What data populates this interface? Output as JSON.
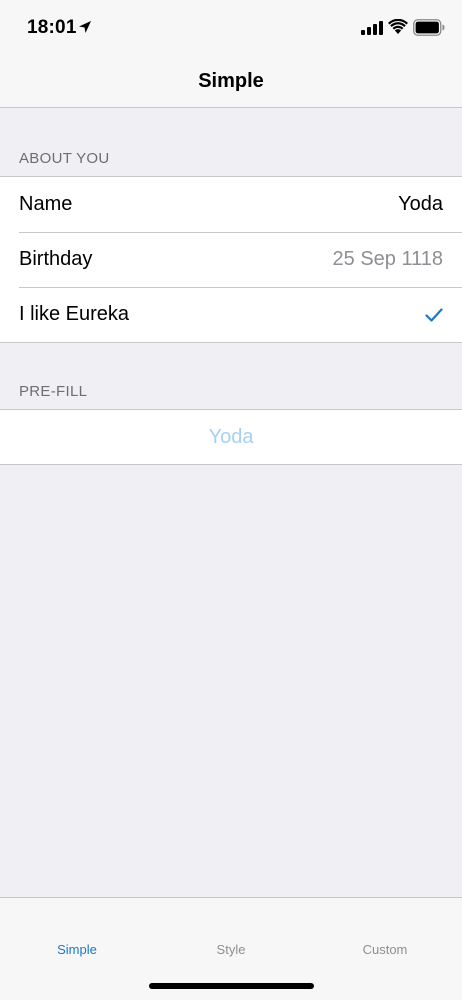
{
  "status_bar": {
    "time": "18:01",
    "icons": [
      "location-arrow-icon",
      "cellular-signal-icon",
      "wifi-icon",
      "battery-icon"
    ]
  },
  "nav": {
    "title": "Simple"
  },
  "sections": {
    "about_you": {
      "header": "ABOUT YOU",
      "rows": [
        {
          "label": "Name",
          "value": "Yoda"
        },
        {
          "label": "Birthday",
          "value": "25 Sep 1118"
        },
        {
          "label": "I like Eureka",
          "checked": true
        }
      ]
    },
    "prefill": {
      "header": "PRE-FILL",
      "value": "Yoda"
    }
  },
  "tab_bar": {
    "tabs": [
      {
        "label": "Simple",
        "selected": true
      },
      {
        "label": "Style",
        "selected": false
      },
      {
        "label": "Custom",
        "selected": false
      }
    ]
  },
  "colors": {
    "accent": "#1a79c8",
    "background": "#efeff4",
    "prefill_text": "#a8d1ef",
    "muted_text": "#8e8e93"
  }
}
